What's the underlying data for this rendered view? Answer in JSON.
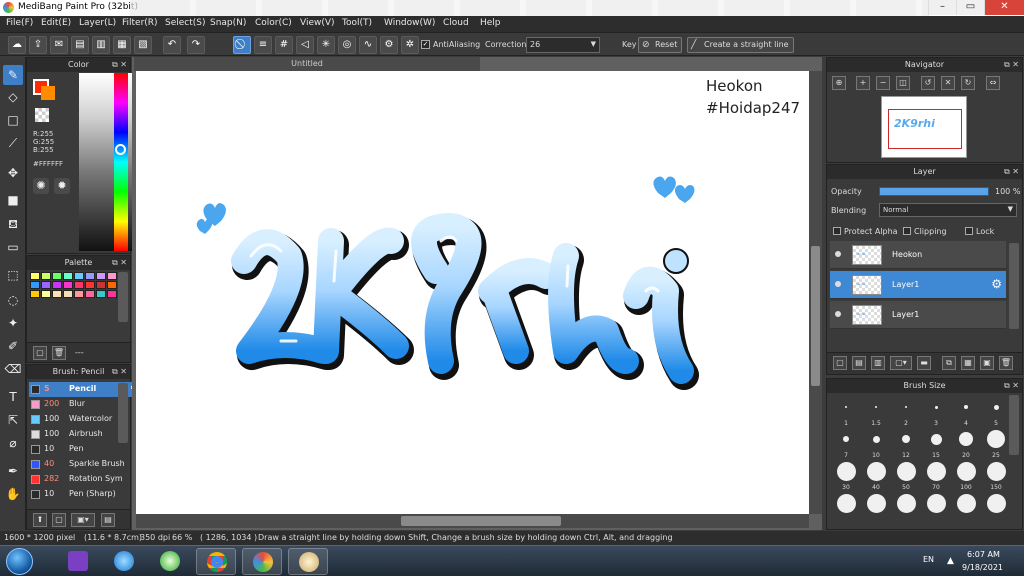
{
  "window": {
    "title": "MediBang Paint Pro (32bit)",
    "controls": [
      "–",
      "▭",
      "✕"
    ]
  },
  "menu": [
    "File(F)",
    "Edit(E)",
    "Layer(L)",
    "Filter(R)",
    "Select(S)",
    "Snap(N)",
    "Color(C)",
    "View(V)",
    "Tool(T)",
    "Window(W)",
    "Cloud",
    "Help"
  ],
  "toolbar": {
    "antialiasing_label": "AntiAliasing",
    "antialiasing_checked": true,
    "correction_label": "Correction",
    "correction_value": "26",
    "key_label": "Key",
    "reset_label": "Reset",
    "straight_line_label": "Create a straight line"
  },
  "color_panel": {
    "title": "Color",
    "r": "R:255",
    "g": "G:255",
    "b": "B:255",
    "hex": "#FFFFFF",
    "foreground": "#ff2a00",
    "background": "#ff8c00"
  },
  "palette_panel": {
    "title": "Palette",
    "footer_label": "---",
    "colors": [
      "#ffff66",
      "#ccff66",
      "#66ff66",
      "#66ffcc",
      "#66ccff",
      "#9999ff",
      "#cc99ff",
      "#ff99cc",
      "#3399ff",
      "#9966ff",
      "#cc33ff",
      "#ff33cc",
      "#ff3366",
      "#ff3333",
      "#cc3333",
      "#ff6600",
      "#ffcc00",
      "#ffff99",
      "#ffe0b3",
      "#f5deb3",
      "#ff9999",
      "#ff6699",
      "#33cccc",
      "#ff3399"
    ]
  },
  "brush_panel": {
    "title": "Brush: Pencil",
    "items": [
      {
        "size": "5",
        "name": "Pencil",
        "color": "#2a2a2a",
        "selected": true
      },
      {
        "size": "200",
        "name": "Blur",
        "color": "#ff99cc",
        "selected": false
      },
      {
        "size": "100",
        "name": "Watercolor",
        "color": "#66ccff",
        "selected": false
      },
      {
        "size": "100",
        "name": "Airbrush",
        "color": "#dddddd",
        "selected": false
      },
      {
        "size": "10",
        "name": "Pen",
        "color": "#2a2a2a",
        "selected": false
      },
      {
        "size": "40",
        "name": "Sparkle Brush",
        "color": "#3355ff",
        "selected": false
      },
      {
        "size": "282",
        "name": "Rotation Sym",
        "color": "#ff3333",
        "selected": false
      },
      {
        "size": "10",
        "name": "Pen (Sharp)",
        "color": "#2a2a2a",
        "selected": false
      }
    ]
  },
  "canvas": {
    "tab_title": "Untitled",
    "signature_line1": "Heokon",
    "signature_line2": "#Hoidap247"
  },
  "navigator": {
    "title": "Navigator",
    "thumb_text": "2K9rhi"
  },
  "layer_panel": {
    "title": "Layer",
    "opacity_label": "Opacity",
    "opacity_value": "100 %",
    "opacity_fraction": 1.0,
    "blending_label": "Blending",
    "blending_value": "Normal",
    "protect_alpha": "Protect Alpha",
    "clipping": "Clipping",
    "lock": "Lock",
    "layers": [
      {
        "name": "Heokon",
        "selected": false
      },
      {
        "name": "Layer1",
        "selected": true
      },
      {
        "name": "Layer1",
        "selected": false
      }
    ]
  },
  "brush_size_panel": {
    "title": "Brush Size",
    "sizes": [
      "1",
      "1.5",
      "2",
      "3",
      "4",
      "5",
      "7",
      "10",
      "12",
      "15",
      "20",
      "25",
      "30",
      "40",
      "50",
      "70",
      "100",
      "150",
      "",
      "",
      "",
      "",
      "",
      ""
    ]
  },
  "status": {
    "dimensions": "1600 * 1200 pixel",
    "physical": "(11.6 * 8.7cm)",
    "dpi": "350 dpi",
    "zoom": "66 %",
    "cursor": "( 1286, 1034 )",
    "hint": "Draw a straight line by holding down Shift, Change a brush size by holding down Ctrl, Alt, and dragging"
  },
  "taskbar": {
    "lang": "EN",
    "time": "6:07 AM",
    "date": "9/18/2021"
  },
  "colors": {
    "accent": "#3f7fc7",
    "panel": "#3a3a3a",
    "lettering_light": "#bfe2ff",
    "lettering_dark": "#1f8ae8"
  }
}
